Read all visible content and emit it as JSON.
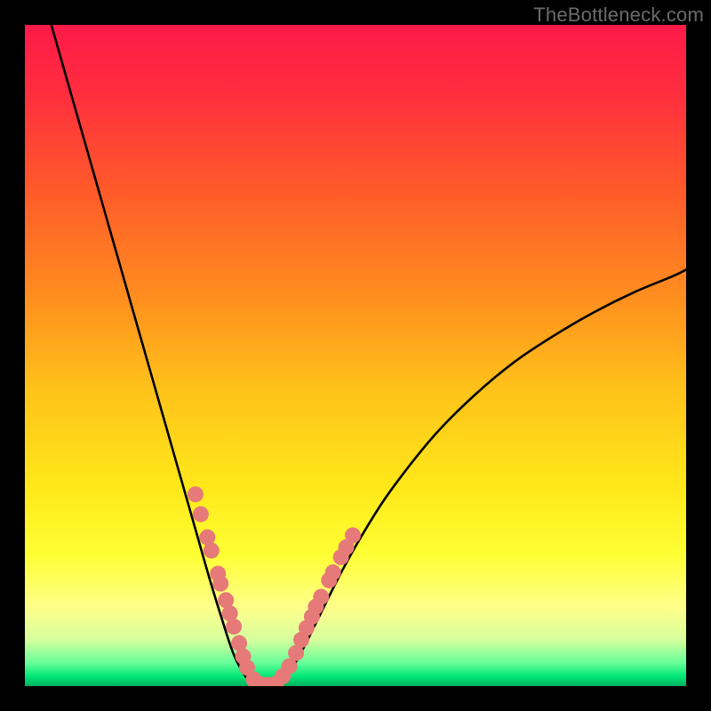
{
  "watermark": "TheBottleneck.com",
  "chart_data": {
    "type": "line",
    "title": "",
    "xlabel": "",
    "ylabel": "",
    "xlim": [
      0,
      100
    ],
    "ylim": [
      0,
      100
    ],
    "gradient_stops": [
      {
        "offset": 0.0,
        "color": "#ff1a49"
      },
      {
        "offset": 0.1,
        "color": "#ff2d3f"
      },
      {
        "offset": 0.25,
        "color": "#ff5a2a"
      },
      {
        "offset": 0.4,
        "color": "#ff8a1f"
      },
      {
        "offset": 0.55,
        "color": "#ffc21a"
      },
      {
        "offset": 0.7,
        "color": "#ffe81a"
      },
      {
        "offset": 0.8,
        "color": "#ffff33"
      },
      {
        "offset": 0.88,
        "color": "#ffff8a"
      },
      {
        "offset": 0.93,
        "color": "#d7ff9e"
      },
      {
        "offset": 0.965,
        "color": "#66ff99"
      },
      {
        "offset": 0.985,
        "color": "#00e877"
      },
      {
        "offset": 1.0,
        "color": "#00b060"
      }
    ],
    "series": [
      {
        "name": "left-branch",
        "x": [
          4.0,
          8.0,
          12.0,
          16.0,
          20.0,
          24.0,
          26.0,
          28.0,
          30.0,
          31.5,
          33.0,
          34.0,
          34.8
        ],
        "y": [
          100.0,
          86.0,
          72.0,
          58.0,
          44.0,
          30.0,
          23.0,
          16.0,
          9.5,
          5.0,
          2.0,
          0.8,
          0.2
        ]
      },
      {
        "name": "valley-floor",
        "x": [
          34.8,
          36.0,
          37.2,
          38.4
        ],
        "y": [
          0.2,
          0.0,
          0.0,
          0.2
        ]
      },
      {
        "name": "right-branch",
        "x": [
          38.4,
          40.0,
          42.0,
          44.0,
          48.0,
          52.0,
          56.0,
          62.0,
          68.0,
          74.0,
          80.0,
          86.0,
          92.0,
          98.0,
          100.0
        ],
        "y": [
          0.2,
          2.0,
          5.5,
          9.5,
          17.5,
          24.5,
          30.5,
          38.0,
          44.0,
          49.0,
          53.0,
          56.5,
          59.5,
          62.0,
          63.0
        ]
      }
    ],
    "scatter": {
      "name": "highlight-dots",
      "color": "#e67a78",
      "radius": 9,
      "points": [
        {
          "x": 25.8,
          "y": 29.0
        },
        {
          "x": 26.6,
          "y": 26.0
        },
        {
          "x": 27.6,
          "y": 22.5
        },
        {
          "x": 28.2,
          "y": 20.5
        },
        {
          "x": 29.2,
          "y": 17.0
        },
        {
          "x": 29.6,
          "y": 15.5
        },
        {
          "x": 30.4,
          "y": 13.0
        },
        {
          "x": 31.0,
          "y": 11.0
        },
        {
          "x": 31.6,
          "y": 9.0
        },
        {
          "x": 32.4,
          "y": 6.5
        },
        {
          "x": 33.0,
          "y": 4.5
        },
        {
          "x": 33.6,
          "y": 2.8
        },
        {
          "x": 34.6,
          "y": 1.0
        },
        {
          "x": 35.6,
          "y": 0.3
        },
        {
          "x": 36.8,
          "y": 0.2
        },
        {
          "x": 38.0,
          "y": 0.4
        },
        {
          "x": 39.0,
          "y": 1.5
        },
        {
          "x": 40.0,
          "y": 3.0
        },
        {
          "x": 41.0,
          "y": 5.0
        },
        {
          "x": 41.8,
          "y": 7.0
        },
        {
          "x": 42.6,
          "y": 8.8
        },
        {
          "x": 43.4,
          "y": 10.5
        },
        {
          "x": 44.0,
          "y": 12.0
        },
        {
          "x": 44.8,
          "y": 13.5
        },
        {
          "x": 46.0,
          "y": 16.0
        },
        {
          "x": 46.6,
          "y": 17.2
        },
        {
          "x": 47.8,
          "y": 19.5
        },
        {
          "x": 48.6,
          "y": 21.0
        },
        {
          "x": 49.6,
          "y": 22.8
        }
      ]
    }
  }
}
